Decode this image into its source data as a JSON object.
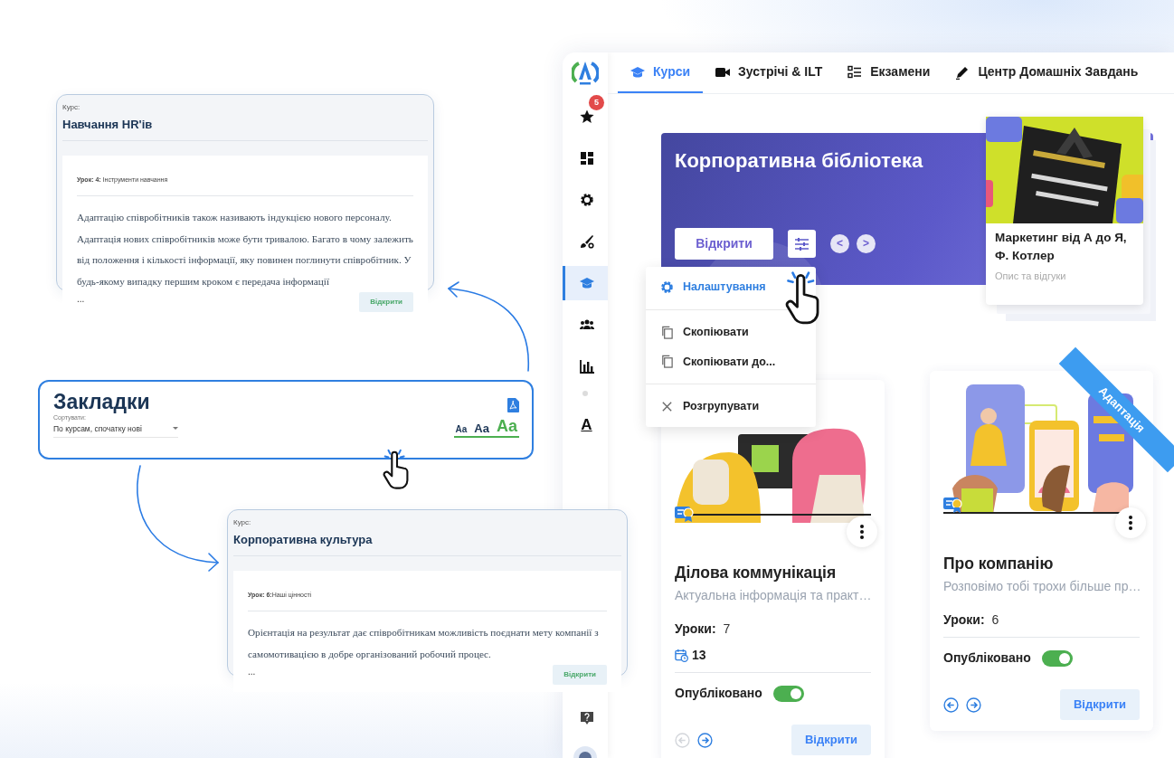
{
  "bookmark_cards": [
    {
      "course_label": "Курс:",
      "course_title": "Навчання HR'ів",
      "lesson": "**Урок: 4:** Інструменти навчання",
      "text": "Адаптацію співробітників також називають індукцією нового персоналу. Адаптація нових співробітників може бути тривалою. Багато в чому залежить від положення і кількості інформації, яку повинен поглинути співробітник. У будь-якому випадку першим кроком є передача інформації",
      "ellipsis": "...",
      "button": "Відкрити"
    },
    {
      "course_label": "Курс:",
      "course_title": "Корпоративна культура",
      "lesson": "**Урок: 6:**Наші цінності",
      "text": "Орієнтація на результат дає співробітникам можливість поєднати мету компанії з самомотивацією в добре організований робочий процес.",
      "ellipsis": "...",
      "button": "Відкрити"
    }
  ],
  "bookmarks_panel": {
    "title": "Закладки",
    "sort_label": "Сортувати:",
    "sort_value": "По курсам, спочатку нові",
    "font_sizes": [
      {
        "label": "Aa",
        "selected": false
      },
      {
        "label": "Aa",
        "selected": false
      },
      {
        "label": "Aa",
        "selected": true
      }
    ]
  },
  "app": {
    "sidebar": {
      "items": [
        {
          "selected": false,
          "badge": "5"
        },
        {
          "selected": false
        },
        {
          "selected": false
        },
        {
          "selected": false
        },
        {
          "selected": true
        },
        {
          "selected": false
        },
        {
          "selected": false
        }
      ],
      "extra_items": [
        {
          "glyph": "A",
          "selected": false
        }
      ]
    },
    "tabs": [
      {
        "label": "Курси",
        "selected": true
      },
      {
        "label": "Зустрічі & ILT",
        "selected": false
      },
      {
        "label": "Екзамени",
        "selected": false
      },
      {
        "label": "Центр Домашніх Завдань",
        "selected": false
      }
    ],
    "banner": {
      "title": "Корпоративна бібліотека",
      "button": "Відкрити",
      "prev": "<",
      "next": ">"
    },
    "book": {
      "title": "Маркетинг від А до Я, Ф. Котлер",
      "subtitle": "Опис та відгуки"
    },
    "menu": {
      "groups": [
        [
          {
            "label": "Налаштування",
            "selected": true
          }
        ],
        [
          {
            "label": "Скопіювати",
            "selected": false
          },
          {
            "label": "Скопіювати до...",
            "selected": false
          }
        ],
        [
          {
            "label": "Розгрупувати",
            "selected": false
          }
        ]
      ]
    },
    "courses": [
      {
        "title": "Ділова коммунікація",
        "description": "Актуальна інформація та практ…",
        "lessons_label": "Уроки:",
        "lessons": "7",
        "events": "13",
        "published_label": "Опубліковано",
        "published": true,
        "prev_disabled": true,
        "next_disabled": false,
        "button": "Відкрити"
      },
      {
        "ribbon": "Адаптація",
        "title": "Про компанію",
        "description": "Розповімо тобі трохи більше пр…",
        "lessons_label": "Уроки:",
        "lessons": "6",
        "published_label": "Опубліковано",
        "published": true,
        "prev_disabled": false,
        "next_disabled": false,
        "button": "Відкрити"
      }
    ]
  }
}
